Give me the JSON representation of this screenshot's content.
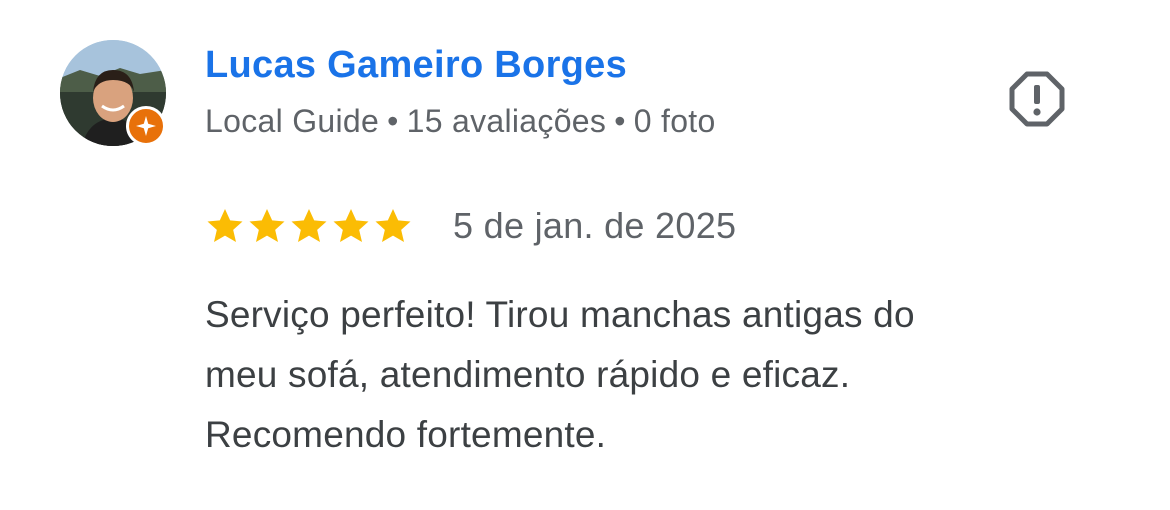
{
  "review": {
    "author": {
      "name": "Lucas Gameiro Borges",
      "badge_icon": "local-guide-star-icon",
      "meta": {
        "level": "Local Guide",
        "separator": "•",
        "reviews": "15 avaliações",
        "photos": "0 foto"
      }
    },
    "rating": {
      "stars": 5,
      "max": 5,
      "star_icon": "star-icon",
      "date": "5 de jan. de 2025"
    },
    "text": {
      "line1": "Serviço perfeito! Tirou manchas antigas do",
      "line2": "meu sofá, atendimento rápido e eficaz.",
      "line3": "Recomendo fortemente."
    },
    "actions": {
      "report_icon": "report-flag-icon"
    }
  },
  "colors": {
    "name_blue": "#1a73e8",
    "meta_gray": "#5f6368",
    "text_dark": "#3c4043",
    "star_gold": "#fbbc04",
    "badge_orange": "#e8710a",
    "icon_gray": "#5f6368"
  }
}
